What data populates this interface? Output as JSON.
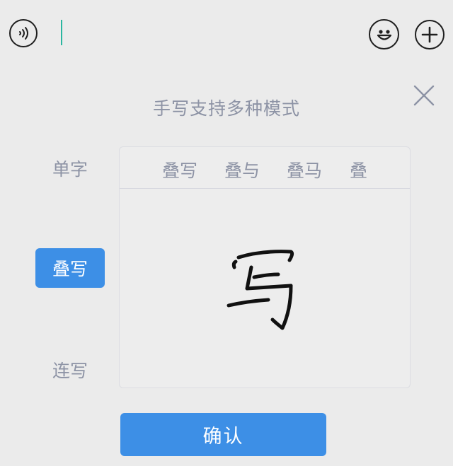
{
  "input_bar": {
    "left_icon": "voice-icon",
    "right_icons": [
      "emoji-icon",
      "plus-icon"
    ],
    "caret_color": "#2bb6a0"
  },
  "handwriting_panel": {
    "hint": "手写支持多种模式",
    "close_icon": "close-icon",
    "modes": [
      {
        "label": "单字",
        "selected": false
      },
      {
        "label": "叠写",
        "selected": true
      },
      {
        "label": "连写",
        "selected": false
      }
    ],
    "candidates": [
      "叠写",
      "叠与",
      "叠马",
      "叠"
    ],
    "handwritten_character": "写",
    "confirm_label": "确认"
  },
  "colors": {
    "accent": "#3d8fe6",
    "muted_text": "#8d93a5",
    "background": "#ebebeb"
  }
}
